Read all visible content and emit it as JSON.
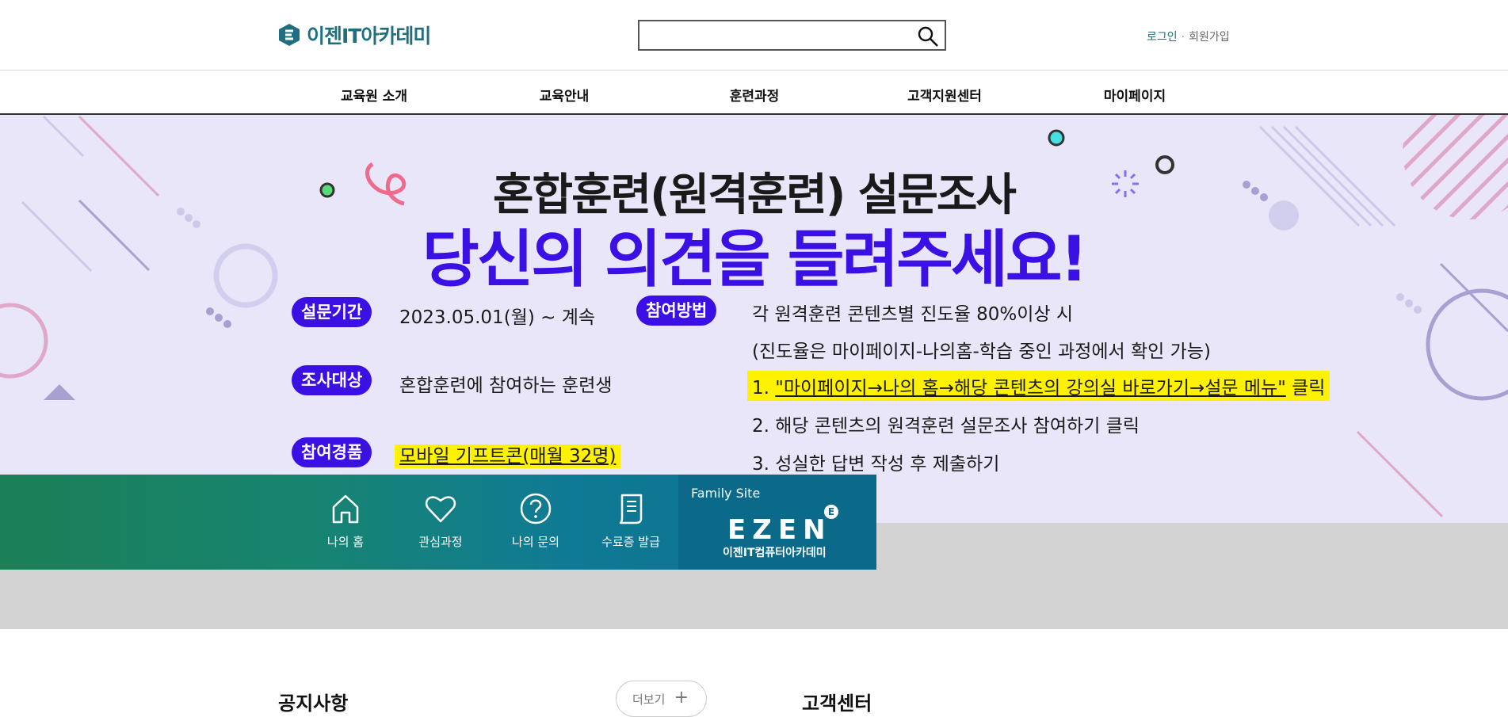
{
  "header": {
    "logo_text": "이젠IT아카데미",
    "search_placeholder": "",
    "login": "로그인",
    "separator": "·",
    "signup": "회원가입"
  },
  "gnb": [
    "교육원 소개",
    "교육안내",
    "훈련과정",
    "고객지원센터",
    "마이페이지"
  ],
  "banner": {
    "title1": "혼합훈련(원격훈련) 설문조사",
    "title2": "당신의 의견을 들려주세요!",
    "period_label": "설문기간",
    "period_value": "2023.05.01(월) ~ 계속",
    "target_label": "조사대상",
    "target_value": "혼합훈련에 참여하는 훈련생",
    "prize_label": "참여경품",
    "prize_value": "모바일 기프트콘(매월 32명)",
    "method_label": "참여방법",
    "method_line1": "각 원격훈련 콘텐츠별 진도율 80%이상 시",
    "method_line2": "(진도율은 마이페이지-나의홈-학습 중인 과정에서 확인 가능)",
    "step1_num": "1.",
    "step1_text": "\"마이페이지→나의 홈→해당 콘텐츠의 강의실 바로가기→설문 메뉴\"",
    "step1_suffix": "클릭",
    "step2": "2. 해당 콘텐츠의 원격훈련 설문조사 참여하기 클릭",
    "step3": "3. 성실한 답변 작성 후 제출하기",
    "accent_color": "#3a10e5",
    "highlight_color": "#fff200"
  },
  "quick_menu": {
    "items": [
      {
        "label": "나의 홈",
        "icon": "home-icon"
      },
      {
        "label": "관심과정",
        "icon": "heart-icon"
      },
      {
        "label": "나의 문의",
        "icon": "question-icon"
      },
      {
        "label": "수료증 발급",
        "icon": "document-icon"
      }
    ],
    "family_site_label": "Family Site",
    "family_logo": "EZEN",
    "family_logo_sub": "이젠IT컴퓨터아카데미",
    "family_badge": "E"
  },
  "bottom": {
    "notice_title": "공지사항",
    "more_label": "더보기",
    "more_plus": "+",
    "customer_title": "고객센터"
  }
}
